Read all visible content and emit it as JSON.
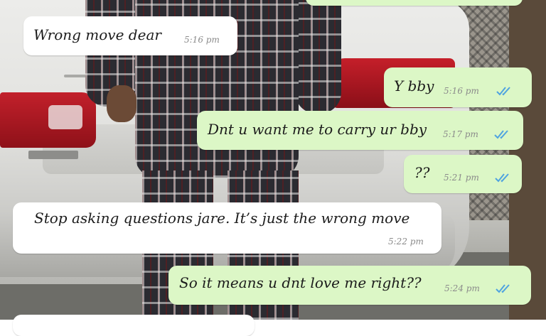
{
  "chat": {
    "messages": [
      {
        "direction": "incoming",
        "text": "Wrong move dear",
        "time": "5:16 pm"
      },
      {
        "direction": "outgoing",
        "text": "Y bby",
        "time": "5:16 pm",
        "status": "read"
      },
      {
        "direction": "outgoing",
        "text": "Dnt u want me to carry ur bby",
        "time": "5:17 pm",
        "status": "read"
      },
      {
        "direction": "outgoing",
        "text": "??",
        "time": "5:21 pm",
        "status": "read"
      },
      {
        "direction": "incoming",
        "text": "Stop asking questions jare. It’s just the wrong move",
        "time": "5:22 pm"
      },
      {
        "direction": "outgoing",
        "text": "So it means u dnt love me right??",
        "time": "5:24 pm",
        "status": "read"
      }
    ]
  },
  "colors": {
    "incoming_bubble": "#ffffff",
    "outgoing_bubble": "#dcf7c6",
    "read_tick": "#4fa3e0",
    "timestamp": "#8b8b8b"
  },
  "icons": {
    "read_status": "double-check-icon"
  }
}
